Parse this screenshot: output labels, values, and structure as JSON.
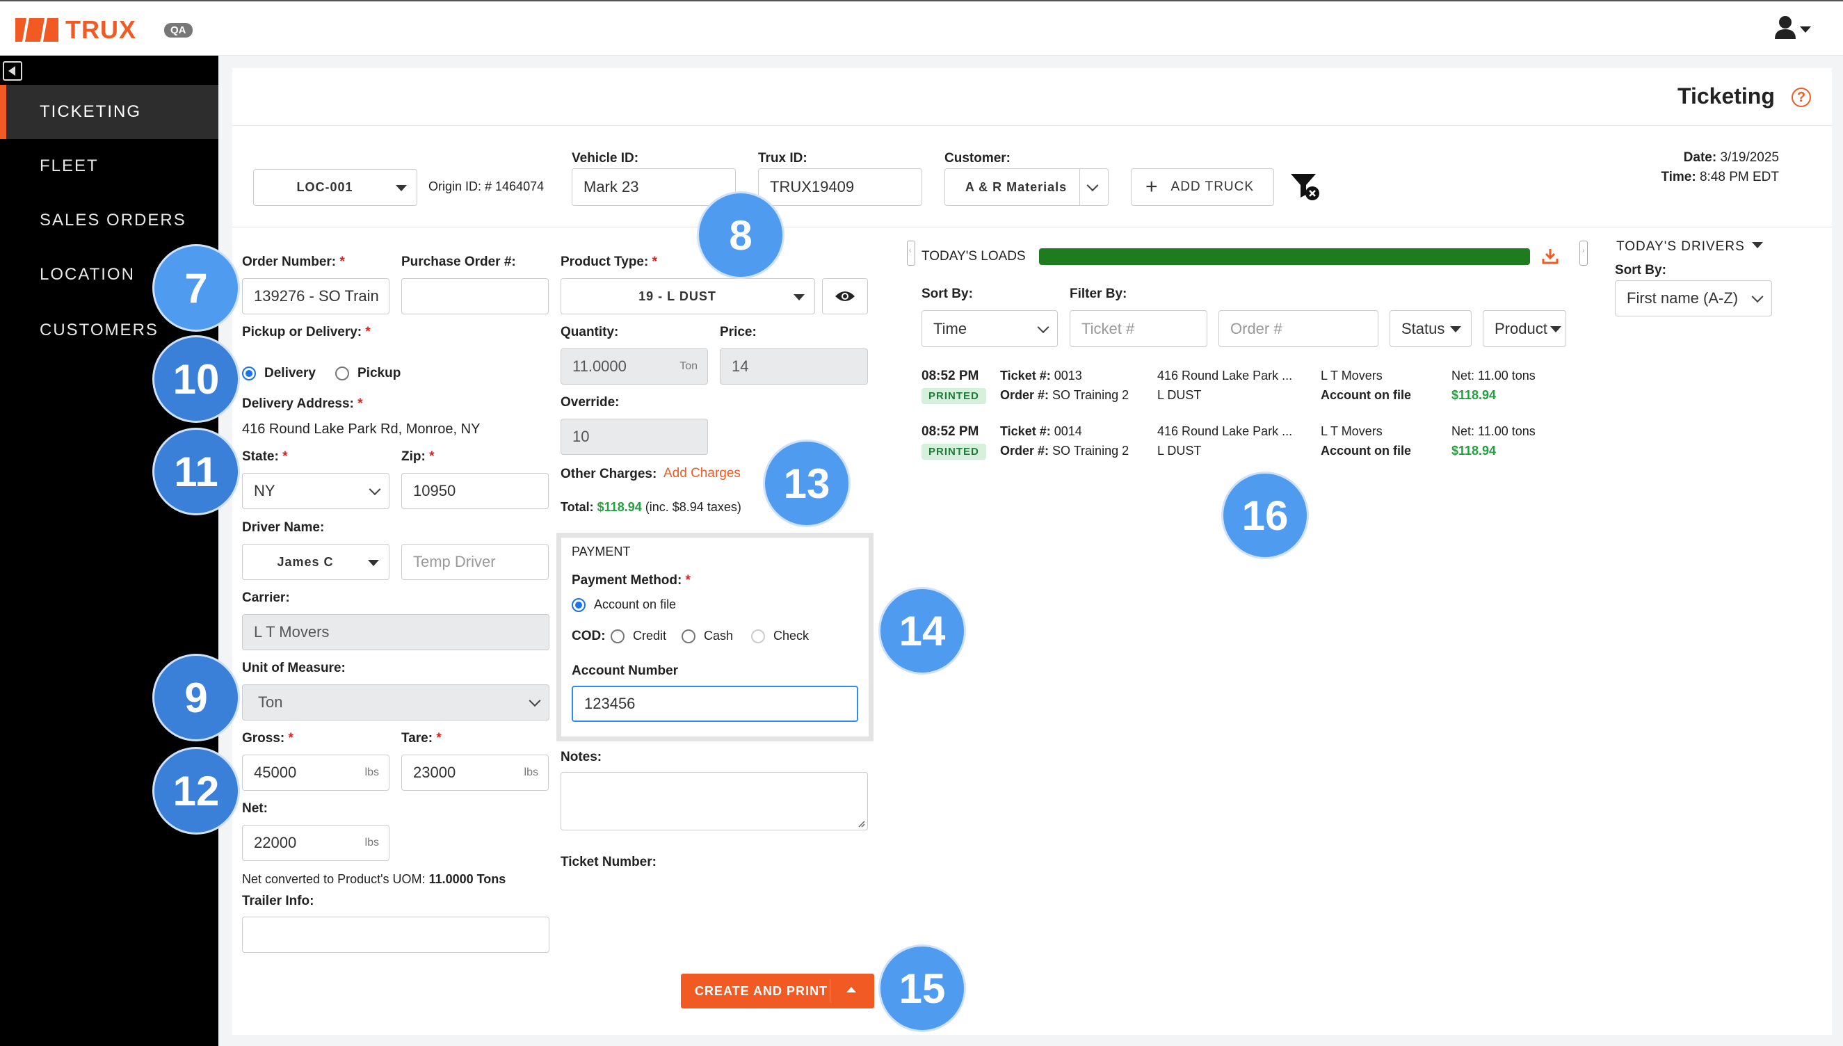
{
  "app": {
    "brand": "TRUX",
    "env_badge": "QA"
  },
  "sidebar": {
    "items": [
      {
        "label": "TICKETING"
      },
      {
        "label": "FLEET"
      },
      {
        "label": "SALES ORDERS"
      },
      {
        "label": "LOCATION"
      },
      {
        "label": "CUSTOMERS"
      }
    ]
  },
  "page": {
    "title": "Ticketing"
  },
  "header": {
    "location_select": "LOC-001",
    "origin_id": "Origin ID: # 1464074",
    "vehicle_id_label": "Vehicle ID:",
    "vehicle_id": "Mark 23",
    "trux_id_label": "Trux ID:",
    "trux_id": "TRUX19409",
    "customer_label": "Customer:",
    "customer": "A & R Materials",
    "add_truck": "ADD TRUCK",
    "date_label": "Date:",
    "date": "3/19/2025",
    "time_label": "Time:",
    "time": "8:48 PM EDT"
  },
  "form": {
    "order_number_label": "Order Number:",
    "order_number": "139276 - SO Train",
    "po_label": "Purchase Order #:",
    "po_value": "",
    "pickup_delivery_label": "Pickup or Delivery:",
    "delivery": "Delivery",
    "pickup": "Pickup",
    "delivery_address_label": "Delivery Address:",
    "delivery_address": "416 Round Lake Park Rd, Monroe, NY",
    "state_label": "State:",
    "state": "NY",
    "zip_label": "Zip:",
    "zip": "10950",
    "driver_label": "Driver Name:",
    "driver": "James C",
    "temp_driver_placeholder": "Temp Driver",
    "carrier_label": "Carrier:",
    "carrier": "L T Movers",
    "uom_label": "Unit of Measure:",
    "uom": "Ton",
    "gross_label": "Gross:",
    "gross": "45000",
    "gross_unit": "lbs",
    "tare_label": "Tare:",
    "tare": "23000",
    "tare_unit": "lbs",
    "net_label": "Net:",
    "net": "22000",
    "net_unit": "lbs",
    "net_converted_prefix": "Net converted to Product's UOM:",
    "net_converted_value": "11.0000 Tons",
    "trailer_label": "Trailer Info:",
    "trailer": "",
    "product_type_label": "Product Type:",
    "product_type": "19 - L DUST",
    "quantity_label": "Quantity:",
    "quantity": "11.0000",
    "quantity_unit": "Ton",
    "price_label": "Price:",
    "price": "14",
    "override_label": "Override:",
    "override": "10",
    "other_charges_label": "Other Charges:",
    "add_charges": "Add Charges",
    "total_label": "Total:",
    "total": "$118.94",
    "total_tax": "(inc. $8.94 taxes)",
    "payment_title": "PAYMENT",
    "payment_method_label": "Payment Method:",
    "account_on_file": "Account on file",
    "cod_label": "COD:",
    "credit": "Credit",
    "cash": "Cash",
    "check": "Check",
    "account_number_label": "Account Number",
    "account_number": "123456",
    "notes_label": "Notes:",
    "notes": "",
    "ticket_number_label": "Ticket Number:",
    "create_print": "CREATE AND PRINT"
  },
  "loads": {
    "title": "TODAY'S LOADS",
    "progress_fraction": 1.0,
    "sort_label": "Sort By:",
    "sort_value": "Time",
    "filter_label": "Filter By:",
    "ticket_placeholder": "Ticket #",
    "order_placeholder": "Order #",
    "status_filter": "Status",
    "product_filter": "Product",
    "rows": [
      {
        "time": "08:52 PM",
        "status": "PRINTED",
        "ticket_label": "Ticket #:",
        "ticket": "0013",
        "order_label": "Order #:",
        "order": "SO Training 2",
        "address": "416 Round Lake Park ...",
        "product": "L DUST",
        "carrier": "L T Movers",
        "payment": "Account on file",
        "net": "Net: 11.00 tons",
        "amount": "$118.94"
      },
      {
        "time": "08:52 PM",
        "status": "PRINTED",
        "ticket_label": "Ticket #:",
        "ticket": "0014",
        "order_label": "Order #:",
        "order": "SO Training 2",
        "address": "416 Round Lake Park ...",
        "product": "L DUST",
        "carrier": "L T Movers",
        "payment": "Account on file",
        "net": "Net: 11.00 tons",
        "amount": "$118.94"
      }
    ]
  },
  "drivers": {
    "title": "TODAY'S DRIVERS",
    "sort_label": "Sort By:",
    "sort_value": "First name (A-Z)"
  },
  "badges": [
    "7",
    "8",
    "9",
    "10",
    "11",
    "12",
    "13",
    "14",
    "15",
    "16"
  ],
  "colors": {
    "accent": "#f15a22",
    "progress": "#1e7b1e",
    "badge": "#4f9bf0",
    "sidebar": "#000000",
    "amount": "#23a03f"
  }
}
